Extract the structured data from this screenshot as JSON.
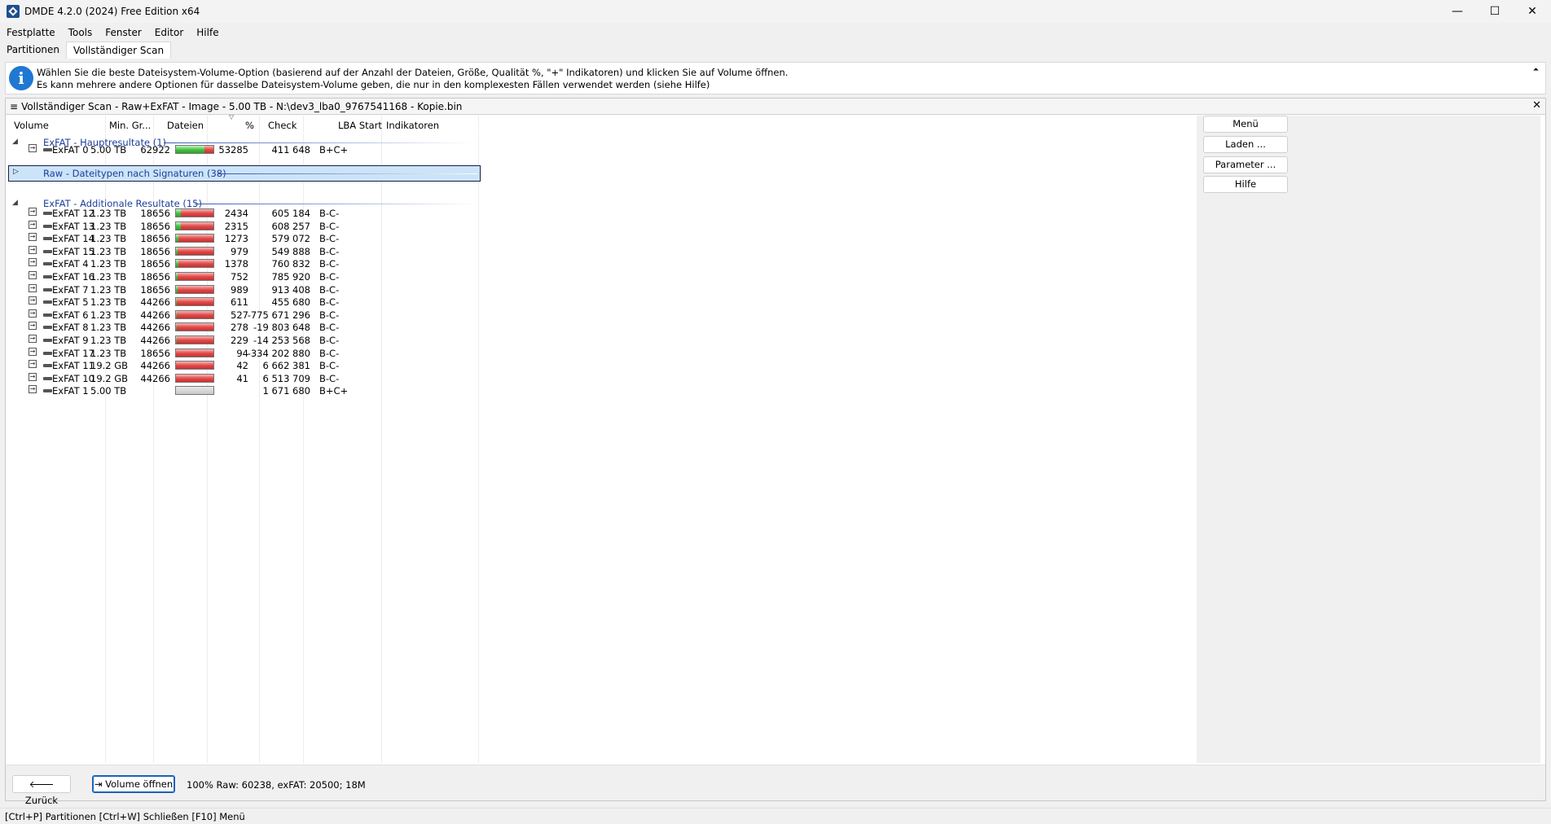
{
  "window": {
    "title": "DMDE 4.2.0 (2024) Free Edition x64",
    "minimize_glyph": "—",
    "maximize_glyph": "☐",
    "close_glyph": "✕"
  },
  "menu": [
    "Festplatte",
    "Tools",
    "Fenster",
    "Editor",
    "Hilfe"
  ],
  "tabs": [
    {
      "label": "Partitionen",
      "active": false
    },
    {
      "label": "Vollständiger Scan",
      "active": true
    }
  ],
  "info": {
    "icon": "info-icon",
    "line1": "Wählen Sie die beste Dateisystem-Volume-Option (basierend auf der Anzahl der Dateien, Größe, Qualität %, \"+\" Indikatoren) und klicken Sie auf Volume öffnen.",
    "line2": "Es kann mehrere andere Optionen für dasselbe Dateisystem-Volume geben, die nur in den komplexesten Fällen verwendet werden (siehe Hilfe)",
    "collapse_glyph": "⏶"
  },
  "panel": {
    "title": "Vollständiger Scan - Raw+ExFAT - Image - 5.00 TB - N:\\dev3_lba0_9767541168 - Kopie.bin",
    "close_glyph": "✕"
  },
  "columns": {
    "volume": "Volume",
    "min_size": "Min. Gr...",
    "files": "Dateien",
    "percent": "%",
    "check": "Check",
    "lba_start": "LBA Start",
    "indicators": "Indikatoren"
  },
  "groups": {
    "main": {
      "label": "ExFAT - Hauptresultate (1)",
      "expander": "◢"
    },
    "raw": {
      "label": "Raw - Dateitypen nach Signaturen (38)",
      "expander": "▷"
    },
    "additional": {
      "label": "ExFAT - Additionale Resultate (15)",
      "expander": "◢"
    }
  },
  "main_rows": [
    {
      "volume": "ExFAT 0",
      "min_size": "5.00 TB",
      "files": "62922",
      "quality": 0.75,
      "check": "53285",
      "lba_start": "411 648",
      "indicators": "B+C+"
    }
  ],
  "additional_rows": [
    {
      "volume": "ExFAT 12",
      "min_size": "1.23 TB",
      "files": "18656",
      "quality": 0.12,
      "check": "2434",
      "lba_start": "605 184",
      "indicators": "B-C-"
    },
    {
      "volume": "ExFAT 13",
      "min_size": "1.23 TB",
      "files": "18656",
      "quality": 0.12,
      "check": "2315",
      "lba_start": "608 257",
      "indicators": "B-C-"
    },
    {
      "volume": "ExFAT 14",
      "min_size": "1.23 TB",
      "files": "18656",
      "quality": 0.07,
      "check": "1273",
      "lba_start": "579 072",
      "indicators": "B-C-"
    },
    {
      "volume": "ExFAT 15",
      "min_size": "1.23 TB",
      "files": "18656",
      "quality": 0.05,
      "check": "979",
      "lba_start": "549 888",
      "indicators": "B-C-"
    },
    {
      "volume": "ExFAT 4",
      "min_size": "1.23 TB",
      "files": "18656",
      "quality": 0.07,
      "check": "1378",
      "lba_start": "760 832",
      "indicators": "B-C-"
    },
    {
      "volume": "ExFAT 16",
      "min_size": "1.23 TB",
      "files": "18656",
      "quality": 0.04,
      "check": "752",
      "lba_start": "785 920",
      "indicators": "B-C-"
    },
    {
      "volume": "ExFAT 7",
      "min_size": "1.23 TB",
      "files": "18656",
      "quality": 0.05,
      "check": "989",
      "lba_start": "913 408",
      "indicators": "B-C-"
    },
    {
      "volume": "ExFAT 5",
      "min_size": "1.23 TB",
      "files": "44266",
      "quality": 0.03,
      "check": "611",
      "lba_start": "455 680",
      "indicators": "B-C-"
    },
    {
      "volume": "ExFAT 6",
      "min_size": "1.23 TB",
      "files": "44266",
      "quality": 0.03,
      "check": "527",
      "lba_start": "-775 671 296",
      "indicators": "B-C-"
    },
    {
      "volume": "ExFAT 8",
      "min_size": "1.23 TB",
      "files": "44266",
      "quality": 0.02,
      "check": "278",
      "lba_start": "-19 803 648",
      "indicators": "B-C-"
    },
    {
      "volume": "ExFAT 9",
      "min_size": "1.23 TB",
      "files": "44266",
      "quality": 0.02,
      "check": "229",
      "lba_start": "-14 253 568",
      "indicators": "B-C-"
    },
    {
      "volume": "ExFAT 17",
      "min_size": "1.23 TB",
      "files": "18656",
      "quality": 0.01,
      "check": "94",
      "lba_start": "-334 202 880",
      "indicators": "B-C-"
    },
    {
      "volume": "ExFAT 11",
      "min_size": "19.2 GB",
      "files": "44266",
      "quality": 0.01,
      "check": "42",
      "lba_start": "6 662 381",
      "indicators": "B-C-"
    },
    {
      "volume": "ExFAT 10",
      "min_size": "19.2 GB",
      "files": "44266",
      "quality": 0.01,
      "check": "41",
      "lba_start": "6 513 709",
      "indicators": "B-C-"
    },
    {
      "volume": "ExFAT 1",
      "min_size": "5.00 TB",
      "files": "",
      "quality": null,
      "check": "",
      "lba_start": "1 671 680",
      "indicators": "B+C+"
    }
  ],
  "side_buttons": [
    "Menü",
    "Laden ...",
    "Parameter ...",
    "Hilfe"
  ],
  "bottom": {
    "back_label": "🡐 Zurück",
    "open_label": "⇥ Volume öffnen",
    "status": "100% Raw: 60238, exFAT: 20500; 18M"
  },
  "statusbar": "[Ctrl+P] Partitionen  [Ctrl+W] Schließen  [F10] Menü",
  "colors": {
    "accent": "#1d3e9a",
    "info": "#1f78d1",
    "bar_good": "#43c043",
    "bar_bad": "#e04848"
  }
}
